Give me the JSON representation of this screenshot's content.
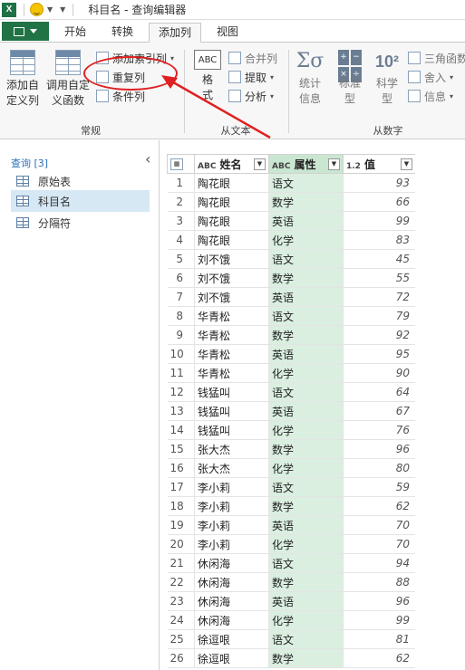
{
  "window": {
    "title": "科目名 - 查询编辑器"
  },
  "tabs": [
    {
      "label": "开始"
    },
    {
      "label": "转换"
    },
    {
      "label": "添加列"
    },
    {
      "label": "视图"
    }
  ],
  "ribbon": {
    "general": {
      "label": "常规",
      "add_custom_col": "添加自\n定义列",
      "invoke_custom_fn": "调用自定\n义函数",
      "add_index_col": "添加索引列",
      "duplicate_col": "重复列",
      "conditional_col": "条件列"
    },
    "from_text": {
      "label": "从文本",
      "format": "格\n式",
      "merge_cols": "合并列",
      "extract": "提取",
      "parse": "分析"
    },
    "from_number": {
      "label": "从数字",
      "statistics": "统计\n信息",
      "standard": "标准\n型",
      "scientific": "科学\n型",
      "trig": "三角函数",
      "rounding": "舍入",
      "information": "信息"
    }
  },
  "queries": {
    "header": "查询 [3]",
    "items": [
      {
        "label": "原始表"
      },
      {
        "label": "科目名"
      },
      {
        "label": "分隔符"
      }
    ]
  },
  "grid": {
    "columns": [
      {
        "type": "ABC",
        "label": "姓名"
      },
      {
        "type": "ABC",
        "label": "属性"
      },
      {
        "type": "1.2",
        "label": "值"
      }
    ],
    "rows": [
      [
        "1",
        "陶花眼",
        "语文",
        "93"
      ],
      [
        "2",
        "陶花眼",
        "数学",
        "66"
      ],
      [
        "3",
        "陶花眼",
        "英语",
        "99"
      ],
      [
        "4",
        "陶花眼",
        "化学",
        "83"
      ],
      [
        "5",
        "刘不饿",
        "语文",
        "45"
      ],
      [
        "6",
        "刘不饿",
        "数学",
        "55"
      ],
      [
        "7",
        "刘不饿",
        "英语",
        "72"
      ],
      [
        "8",
        "华青松",
        "语文",
        "79"
      ],
      [
        "9",
        "华青松",
        "数学",
        "92"
      ],
      [
        "10",
        "华青松",
        "英语",
        "95"
      ],
      [
        "11",
        "华青松",
        "化学",
        "90"
      ],
      [
        "12",
        "钱猛叫",
        "语文",
        "64"
      ],
      [
        "13",
        "钱猛叫",
        "英语",
        "67"
      ],
      [
        "14",
        "钱猛叫",
        "化学",
        "76"
      ],
      [
        "15",
        "张大杰",
        "数学",
        "96"
      ],
      [
        "16",
        "张大杰",
        "化学",
        "80"
      ],
      [
        "17",
        "李小莉",
        "语文",
        "59"
      ],
      [
        "18",
        "李小莉",
        "数学",
        "62"
      ],
      [
        "19",
        "李小莉",
        "英语",
        "70"
      ],
      [
        "20",
        "李小莉",
        "化学",
        "70"
      ],
      [
        "21",
        "休闲海",
        "语文",
        "94"
      ],
      [
        "22",
        "休闲海",
        "数学",
        "88"
      ],
      [
        "23",
        "休闲海",
        "英语",
        "96"
      ],
      [
        "24",
        "休闲海",
        "化学",
        "99"
      ],
      [
        "25",
        "徐逗哏",
        "语文",
        "81"
      ],
      [
        "26",
        "徐逗哏",
        "数学",
        "62"
      ]
    ]
  },
  "colors": {
    "excel_green": "#217346",
    "selected_column": "#dbefe1",
    "annotation_red": "#e02020",
    "query_selected": "#d7e8f5"
  }
}
